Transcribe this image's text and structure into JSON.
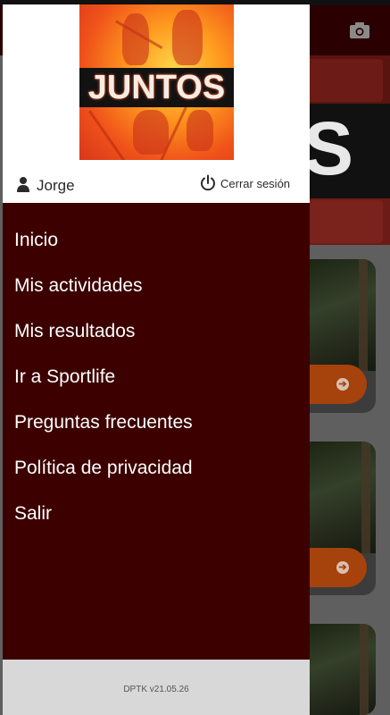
{
  "app": {
    "logo_text": "JUNTOS"
  },
  "user": {
    "name": "Jorge",
    "logout_label": "Cerrar sesión"
  },
  "menu": {
    "items": [
      {
        "label": "Inicio"
      },
      {
        "label": "Mis actividades"
      },
      {
        "label": "Mis resultados"
      },
      {
        "label": "Ir a Sportlife"
      },
      {
        "label": "Preguntas frecuentes"
      },
      {
        "label": "Política de privacidad"
      },
      {
        "label": "Salir"
      }
    ]
  },
  "footer": {
    "version": "DPTK v21.05.26"
  },
  "icons": {
    "user": "user-icon",
    "power": "power-icon",
    "camera": "camera-icon",
    "arrow": "arrow-right-circle-icon"
  },
  "colors": {
    "drawer_bg": "#3c0000",
    "header_bg": "#ffffff",
    "footer_bg": "#d8d8d8",
    "accent_orange": "#a6420b",
    "toolbar_bg": "#2a0000"
  }
}
